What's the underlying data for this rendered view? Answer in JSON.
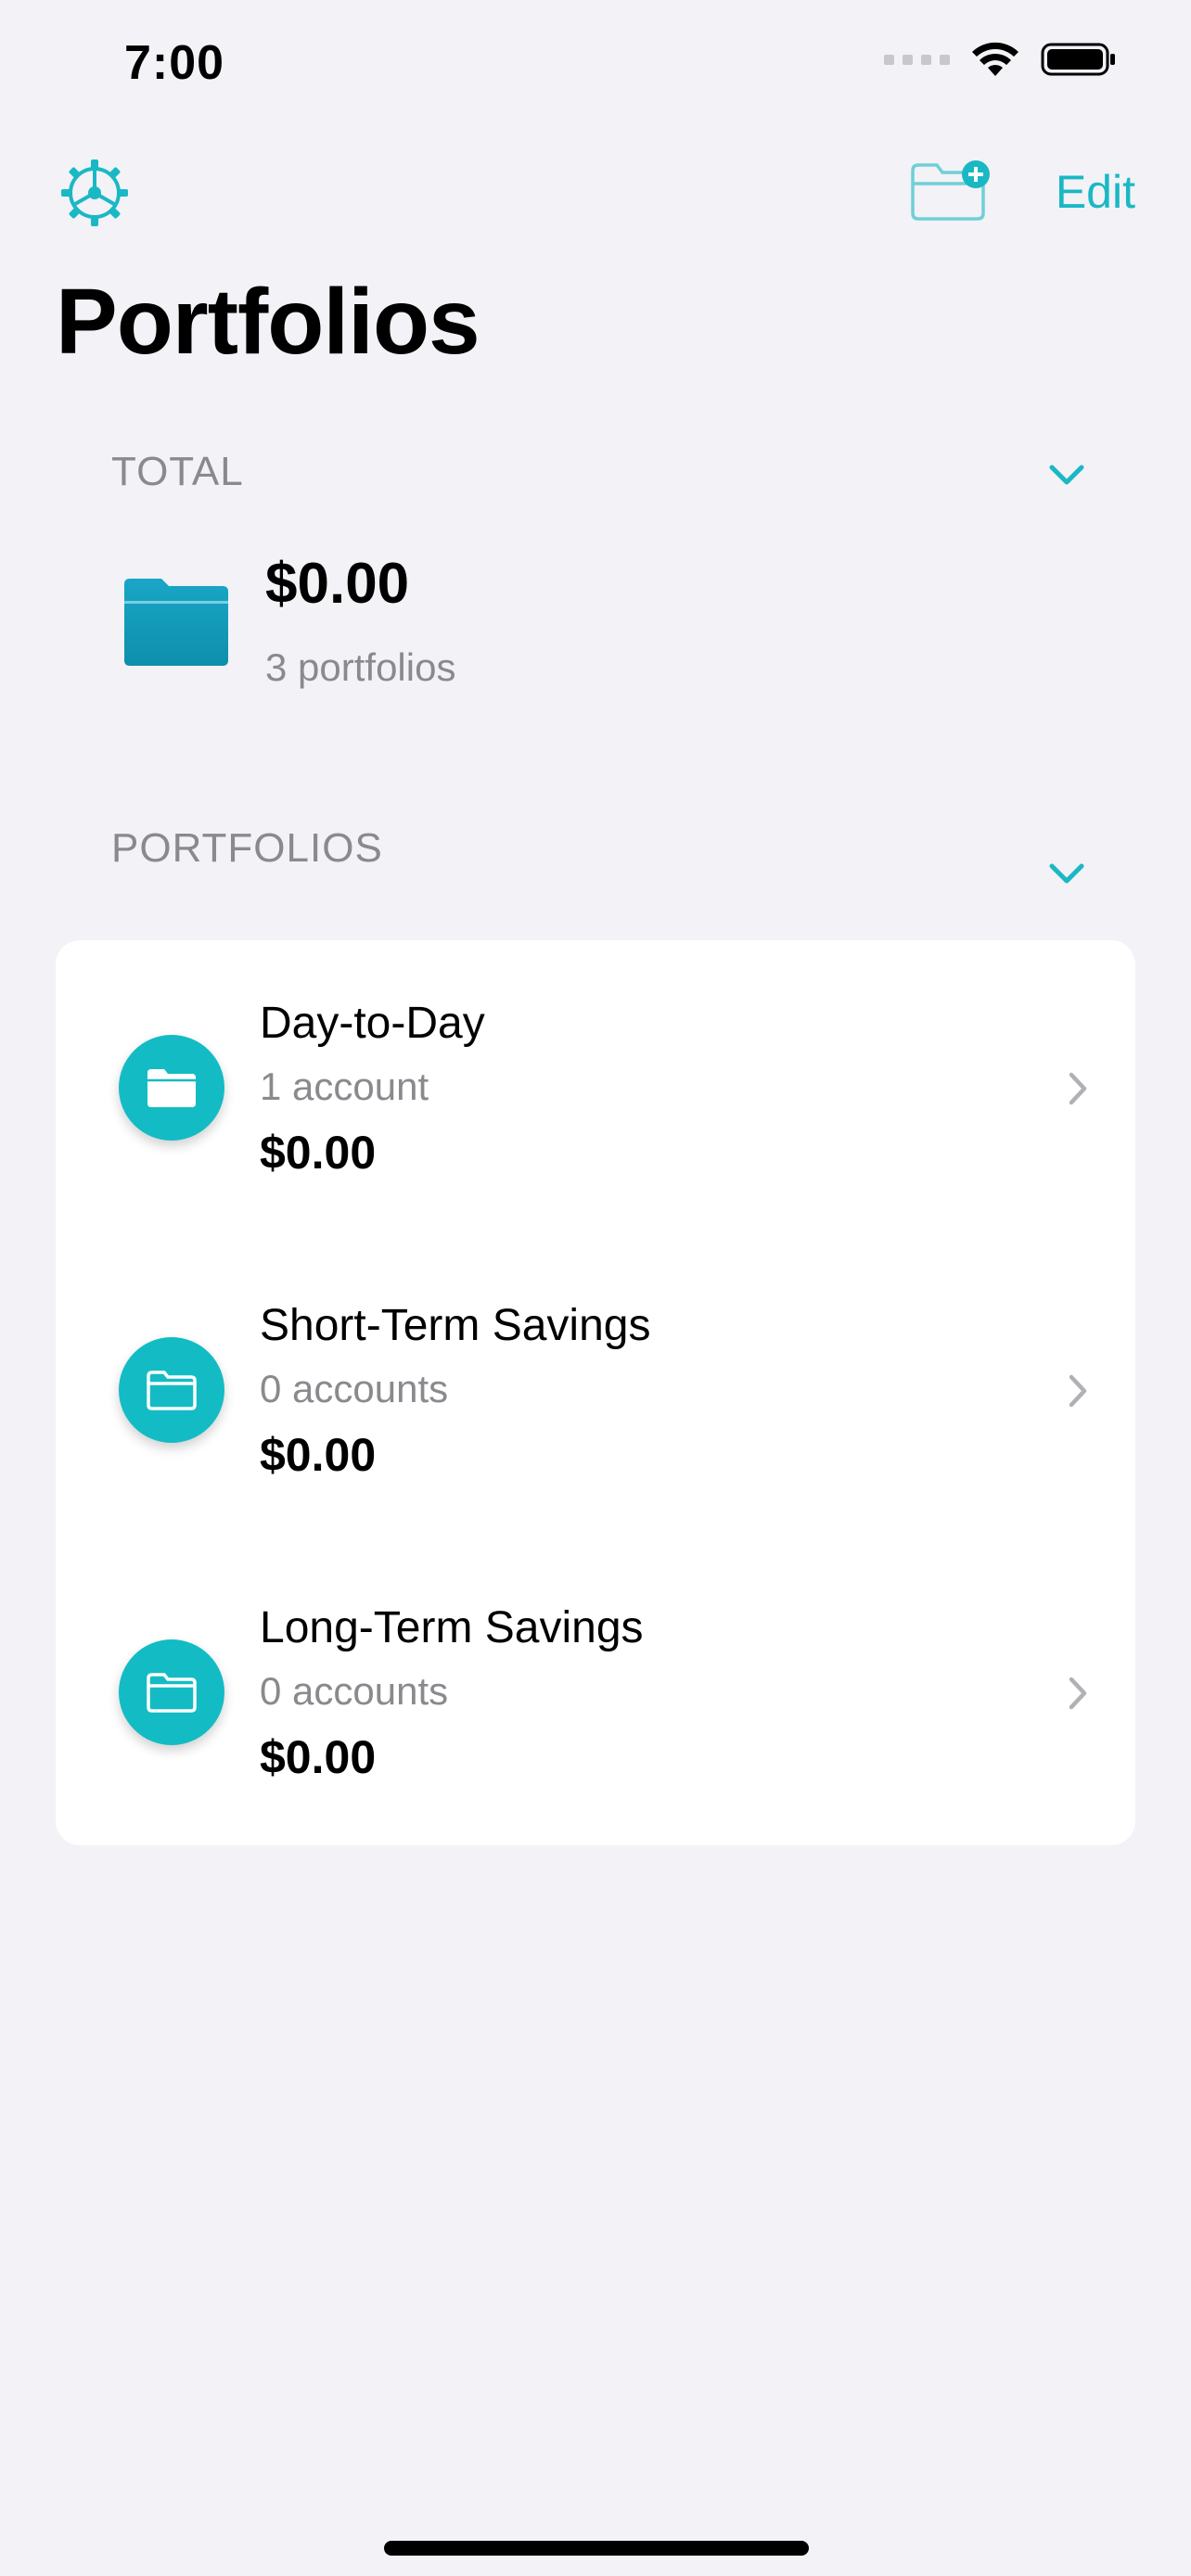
{
  "status_bar": {
    "time": "7:00"
  },
  "toolbar": {
    "edit_label": "Edit"
  },
  "page": {
    "title": "Portfolios"
  },
  "total_section": {
    "header": "TOTAL",
    "amount": "$0.00",
    "subtitle": "3 portfolios"
  },
  "portfolios_section": {
    "header": "PORTFOLIOS",
    "items": [
      {
        "name": "Day-to-Day",
        "count": "1 account",
        "amount": "$0.00",
        "icon": "folder-filled-icon"
      },
      {
        "name": "Short-Term Savings",
        "count": "0 accounts",
        "amount": "$0.00",
        "icon": "folder-outline-icon"
      },
      {
        "name": "Long-Term Savings",
        "count": "0 accounts",
        "amount": "$0.00",
        "icon": "folder-outline-icon"
      }
    ]
  },
  "colors": {
    "accent": "#1ab8c4",
    "background": "#f2f2f7",
    "secondary_text": "#8a8a8e"
  }
}
